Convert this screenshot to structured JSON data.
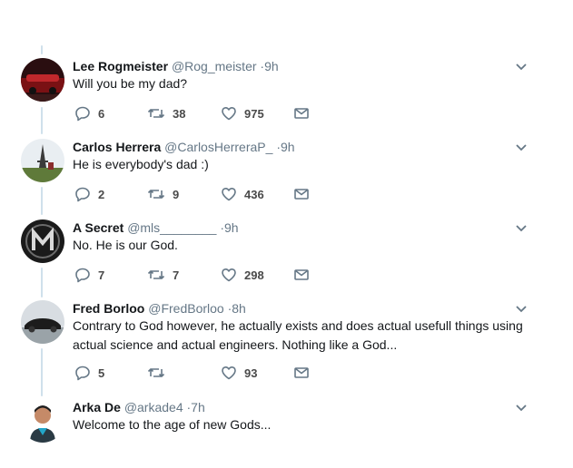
{
  "tweets": [
    {
      "name": "Lee Rogmeister",
      "handle": "@Rog_meister",
      "time": "·9h",
      "text": "Will you be my dad?",
      "replies": "6",
      "retweets": "38",
      "likes": "975",
      "avatar": "red-car-avatar"
    },
    {
      "name": "Carlos Herrera",
      "handle": "@CarlosHerreraP_",
      "time": "·9h",
      "text": "He is everybody's dad :)",
      "replies": "2",
      "retweets": "9",
      "likes": "436",
      "avatar": "eiffel-tower-avatar"
    },
    {
      "name": "A Secret",
      "handle": "@mls________",
      "time": "·9h",
      "text": "No. He is our God.",
      "replies": "7",
      "retweets": "7",
      "likes": "298",
      "avatar": "m-logo-avatar"
    },
    {
      "name": "Fred Borloo",
      "handle": "@FredBorloo",
      "time": "·8h",
      "text": "Contrary to God however, he actually exists and does actual usefull things using actual science and actual engineers. Nothing like a God...",
      "replies": "5",
      "retweets": "",
      "likes": "93",
      "avatar": "black-car-avatar"
    },
    {
      "name": "Arka De",
      "handle": "@arkade4",
      "time": "·7h",
      "text": "Welcome to the age of new Gods...",
      "replies": "",
      "retweets": "",
      "likes": "",
      "avatar": "person-avatar"
    }
  ],
  "colors": {
    "thread_line": "#cfe0eb",
    "icon": "#657786",
    "name": "#14171a"
  }
}
